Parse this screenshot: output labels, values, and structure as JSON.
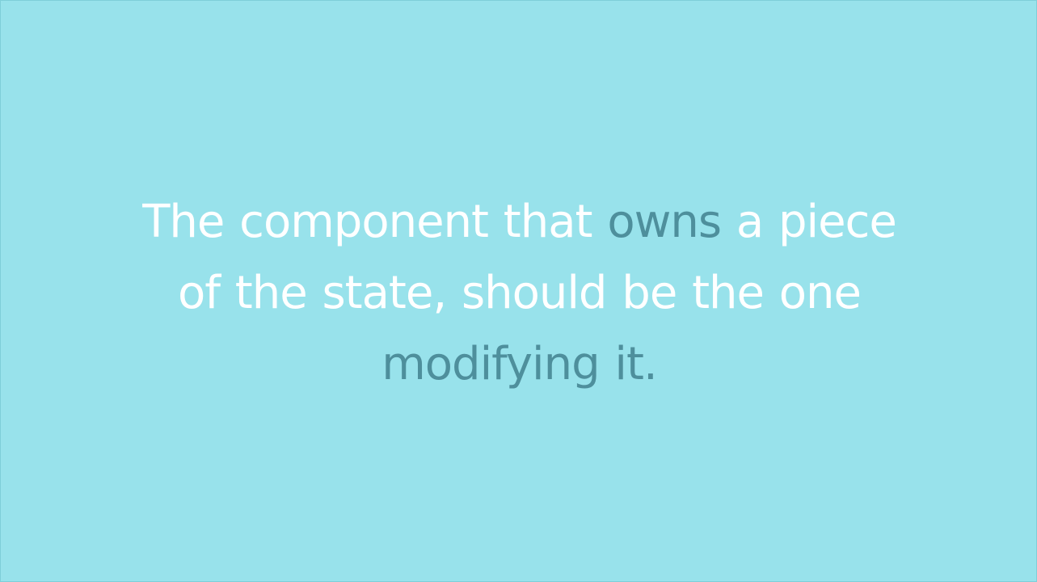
{
  "background_color": "#98e2eb",
  "colors": {
    "text_primary": "#ffffff",
    "text_accent": "#4e8f9c"
  },
  "quote": {
    "line1": {
      "part1": "The component that ",
      "accent": "owns",
      "part2": " a piece"
    },
    "line2": {
      "text": "of the state, should be the one"
    },
    "line3": {
      "accent": "modifying",
      "part2": " it."
    }
  }
}
